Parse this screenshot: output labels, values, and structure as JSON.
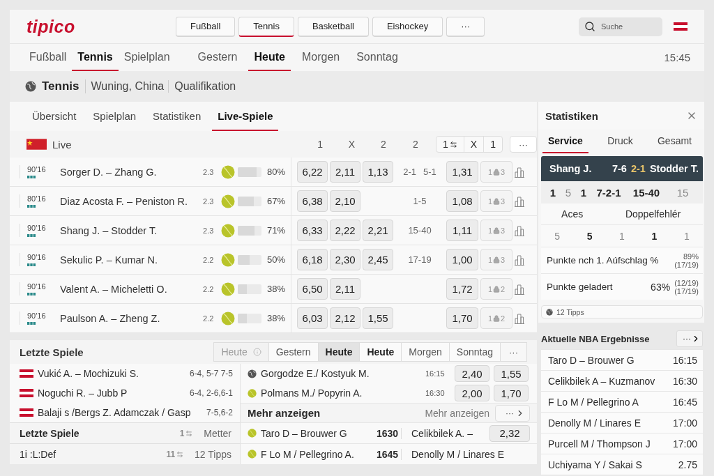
{
  "header": {
    "logo": "tipico",
    "sports": [
      {
        "label": "Fußball",
        "selected": false
      },
      {
        "label": "Tennis",
        "selected": true
      },
      {
        "label": "Basketball",
        "selected": false
      },
      {
        "label": "Eishockey",
        "selected": false
      }
    ],
    "more": "···",
    "search": {
      "placeholder": "Suche"
    }
  },
  "nav": {
    "items": [
      {
        "label": "Fußball",
        "selected": false
      },
      {
        "label": "Tennis",
        "selected": true
      },
      {
        "label": "Spielplan",
        "selected": false
      }
    ],
    "days": [
      {
        "label": "Gestern",
        "selected": false
      },
      {
        "label": "Heute",
        "selected": true
      },
      {
        "label": "Morgen",
        "selected": false
      },
      {
        "label": "Sonntag",
        "selected": false
      }
    ],
    "time": "15:45"
  },
  "breadcrumb": {
    "sport": "Tennis",
    "parts": [
      "Wuning, China",
      "Qualifikation"
    ]
  },
  "tabs": [
    {
      "label": "Übersicht",
      "selected": false
    },
    {
      "label": "Spielplan",
      "selected": false
    },
    {
      "label": "Statistiken",
      "selected": false
    },
    {
      "label": "Live-Spiele",
      "selected": true
    }
  ],
  "live": {
    "label": "Live",
    "columns": [
      "1",
      "X",
      "2",
      "2"
    ],
    "group": [
      "1",
      "X",
      "1"
    ],
    "more": "···",
    "matches": [
      {
        "time": "90'16",
        "name": "Sorger D. – Zhang G.",
        "set": "2.3",
        "pct": "80%",
        "level": 0.8,
        "odds": [
          "6,22",
          "2,11",
          "1,13"
        ],
        "score": [
          "2-1",
          "5-1"
        ],
        "odd": "1,31",
        "locked": [
          "1",
          "3"
        ]
      },
      {
        "time": "80'16",
        "name": "Diaz Acosta F. – Peniston R.",
        "set": "2.3",
        "pct": "67%",
        "level": 0.67,
        "odds": [
          "6,38",
          "2,10"
        ],
        "score": [
          "1-5"
        ],
        "odd": "1,08",
        "locked": [
          "1",
          "3"
        ]
      },
      {
        "time": "90'16",
        "name": "Shang J. – Stodder T.",
        "set": "2.3",
        "pct": "71%",
        "level": 0.71,
        "odds": [
          "6,33",
          "2,22",
          "2,21"
        ],
        "score": [
          "15-40"
        ],
        "odd": "1,11",
        "locked": [
          "1",
          "3"
        ]
      },
      {
        "time": "90'16",
        "name": "Sekulic P. – Kumar N.",
        "set": "2.2",
        "pct": "50%",
        "level": 0.5,
        "odds": [
          "6,18",
          "2,30",
          "2,45"
        ],
        "score": [
          "17-19"
        ],
        "odd": "1,00",
        "locked": [
          "1",
          "3"
        ]
      },
      {
        "time": "90'16",
        "name": "Valent A. – Micheletti O.",
        "set": "2.2",
        "pct": "38%",
        "level": 0.38,
        "odds": [
          "6,50",
          "2,11"
        ],
        "odd": "1,72",
        "locked": [
          "1",
          "2"
        ]
      },
      {
        "time": "90'16",
        "name": "Paulson A. – Zheng Z.",
        "set": "2.2",
        "pct": "38%",
        "level": 0.38,
        "odds": [
          "6,03",
          "2,12",
          "1,55"
        ],
        "odd": "1,70",
        "locked": [
          "1",
          "2"
        ]
      }
    ]
  },
  "recent": {
    "title": "Letzte Spiele",
    "tabs": [
      {
        "label": "Heute",
        "selected": false,
        "bold": false,
        "info": true
      },
      {
        "label": "Gestern",
        "selected": false,
        "bold": false,
        "info": false
      },
      {
        "label": "Heute",
        "selected": true,
        "bold": true,
        "info": false
      },
      {
        "label": "Heute",
        "selected": false,
        "bold": true,
        "info": false
      },
      {
        "label": "Morgen",
        "selected": false,
        "bold": false,
        "info": false
      },
      {
        "label": "Sonntag",
        "selected": false,
        "bold": false,
        "info": false
      }
    ],
    "more": "···",
    "results": [
      {
        "name": "Vukić A. –  Mochizuki S.",
        "score": "6-4, 5-7 7-5"
      },
      {
        "name": "Noguchi R. – Jubb P",
        "score": "6-4, 2-6,6-1"
      },
      {
        "name": "Balaji s /Bergs Z. Adamczak / Gasp",
        "score": "7-5,6-2"
      }
    ],
    "sub": {
      "title": "Letzte Spiele",
      "tag": "1",
      "label": "Metter"
    },
    "sub_row": {
      "name": "1i :L:Def",
      "tag": "11",
      "label": "12 Tipps"
    },
    "upcoming": [
      {
        "kind": "globe",
        "name": "Gorgodze E./ Kostyuk M.",
        "time": "16:15",
        "odds": [
          "2,40",
          "1,55"
        ]
      },
      {
        "kind": "ball",
        "name": "Polmans M./ Popyrin A.",
        "time": "16:30",
        "odds": [
          "2,00",
          "1,70"
        ]
      }
    ],
    "show_more": {
      "title": "Mehr anzeigen",
      "link": "Mehr anzeigen",
      "more": "···"
    },
    "featured": [
      {
        "name": "Taro D  –  Brouwer G",
        "time": "1630",
        "opponent": "Celikbilek A. –",
        "odd": "2,32"
      },
      {
        "name": "F Lo M / Pellegrino A.",
        "time": "1645",
        "opponent": "Denolly M / Linares E"
      }
    ]
  },
  "stats": {
    "title": "Statistiken",
    "tabs": [
      {
        "label": "Service",
        "selected": true
      },
      {
        "label": "Druck",
        "selected": false
      },
      {
        "label": "Gesamt",
        "selected": false
      }
    ],
    "score": {
      "home": "Shang J.",
      "sets": "7-6",
      "game": "2-1",
      "away": "Stodder T."
    },
    "score_row": [
      "1",
      "5",
      "1",
      "7-2-1",
      "15-40",
      "15"
    ],
    "labels": [
      "Aces",
      "Doppelfehlér"
    ],
    "counts": [
      "5",
      "5",
      "1",
      "1",
      "1"
    ],
    "rows": [
      {
        "label": "Punkte nch 1. Aúfschlag %",
        "notes": [
          "89%",
          "(17/19)"
        ]
      },
      {
        "label": "Punkte geladert",
        "value": "63%",
        "notes": [
          "(12/19)",
          "(17/19)"
        ]
      }
    ],
    "tips": "12 Tipps"
  },
  "nba": {
    "title": "Aktuelle NBA Ergebnisse",
    "more": "···",
    "rows": [
      {
        "name": "Taro D  –  Brouwer G",
        "time": "16:15"
      },
      {
        "name": "Celikbilek A – Kuzmanov",
        "time": "16:30"
      },
      {
        "name": "F Lo M / Pellegrino A",
        "time": "16:45"
      },
      {
        "name": "Denolly M / Linares E",
        "time": "17:00"
      },
      {
        "name": "Purcell M / Thompson J",
        "time": "17:00"
      },
      {
        "name": "Uchiyama Y / Sakai S",
        "time": "2.75"
      }
    ]
  }
}
